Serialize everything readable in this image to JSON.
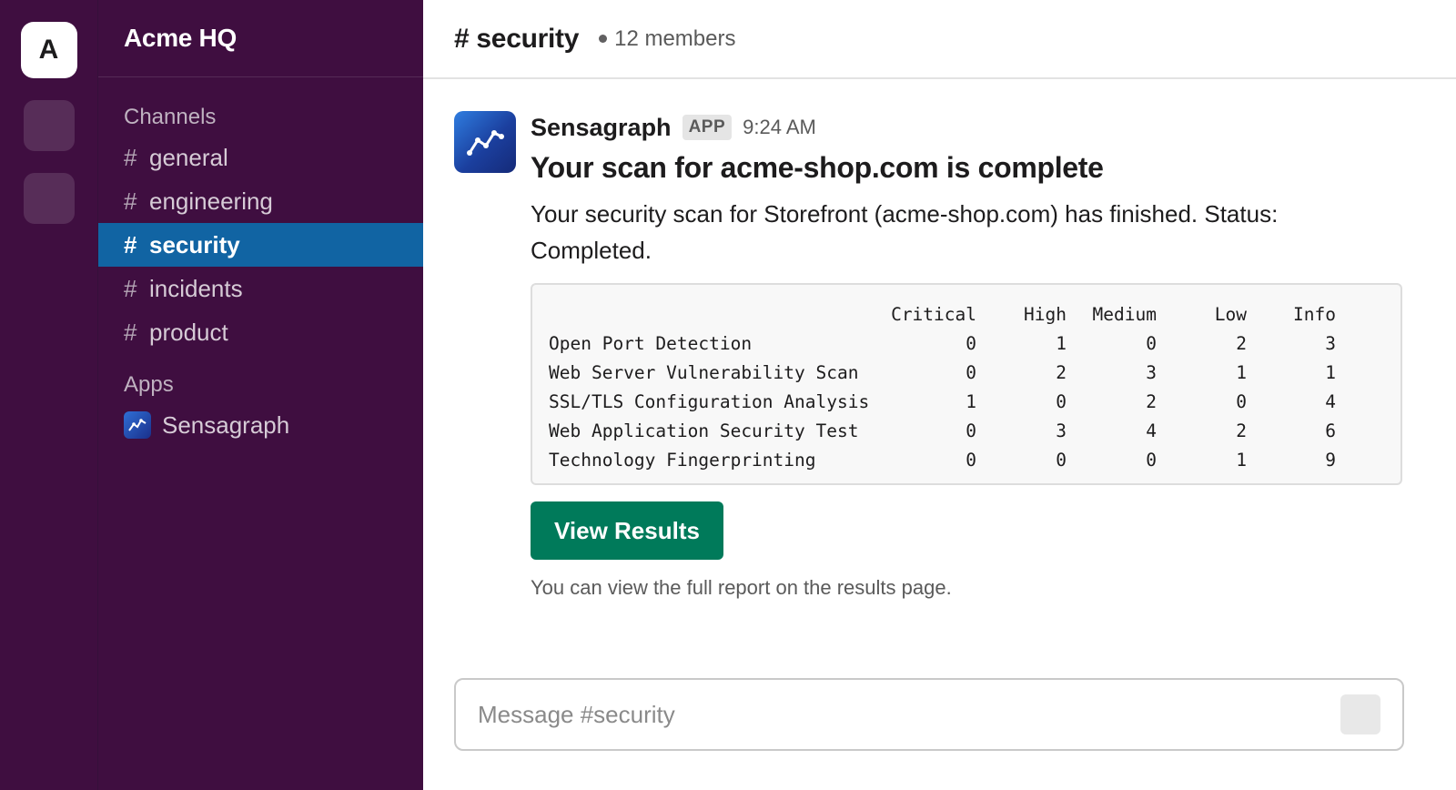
{
  "workspace": {
    "initial": "A",
    "name": "Acme HQ"
  },
  "sidebar": {
    "channels_title": "Channels",
    "channels": [
      {
        "name": "general"
      },
      {
        "name": "engineering"
      },
      {
        "name": "security",
        "active": true
      },
      {
        "name": "incidents"
      },
      {
        "name": "product"
      }
    ],
    "apps_title": "Apps",
    "apps": [
      {
        "name": "Sensagraph",
        "icon": "sensagraph-logo-icon"
      }
    ],
    "hash": "#"
  },
  "header": {
    "title": "# security",
    "members": "12 members"
  },
  "message": {
    "sender": "Sensagraph",
    "badge": "APP",
    "time": "9:24 AM",
    "headline": "Your scan for acme-shop.com is complete",
    "summary": "Your security scan for Storefront (acme-shop.com) has finished. Status: Completed.",
    "table": {
      "columns": [
        "Critical",
        "High",
        "Medium",
        "Low",
        "Info"
      ],
      "rows": [
        {
          "name": "Open Port Detection",
          "values": [
            "0",
            "1",
            "0",
            "2",
            "3"
          ]
        },
        {
          "name": "Web Server Vulnerability Scan",
          "values": [
            "0",
            "2",
            "3",
            "1",
            "1"
          ]
        },
        {
          "name": "SSL/TLS Configuration Analysis",
          "values": [
            "1",
            "0",
            "2",
            "0",
            "4"
          ]
        },
        {
          "name": "Web Application Security Test",
          "values": [
            "0",
            "3",
            "4",
            "2",
            "6"
          ]
        },
        {
          "name": "Technology Fingerprinting",
          "values": [
            "0",
            "0",
            "0",
            "1",
            "9"
          ]
        }
      ]
    },
    "button_label": "View Results",
    "footnote": "You can view the full report on the results page."
  },
  "composer": {
    "placeholder": "Message #security"
  },
  "colors": {
    "sidebar_bg": "#3f0e40",
    "active_channel": "#1164a3",
    "button": "#007a5a"
  }
}
